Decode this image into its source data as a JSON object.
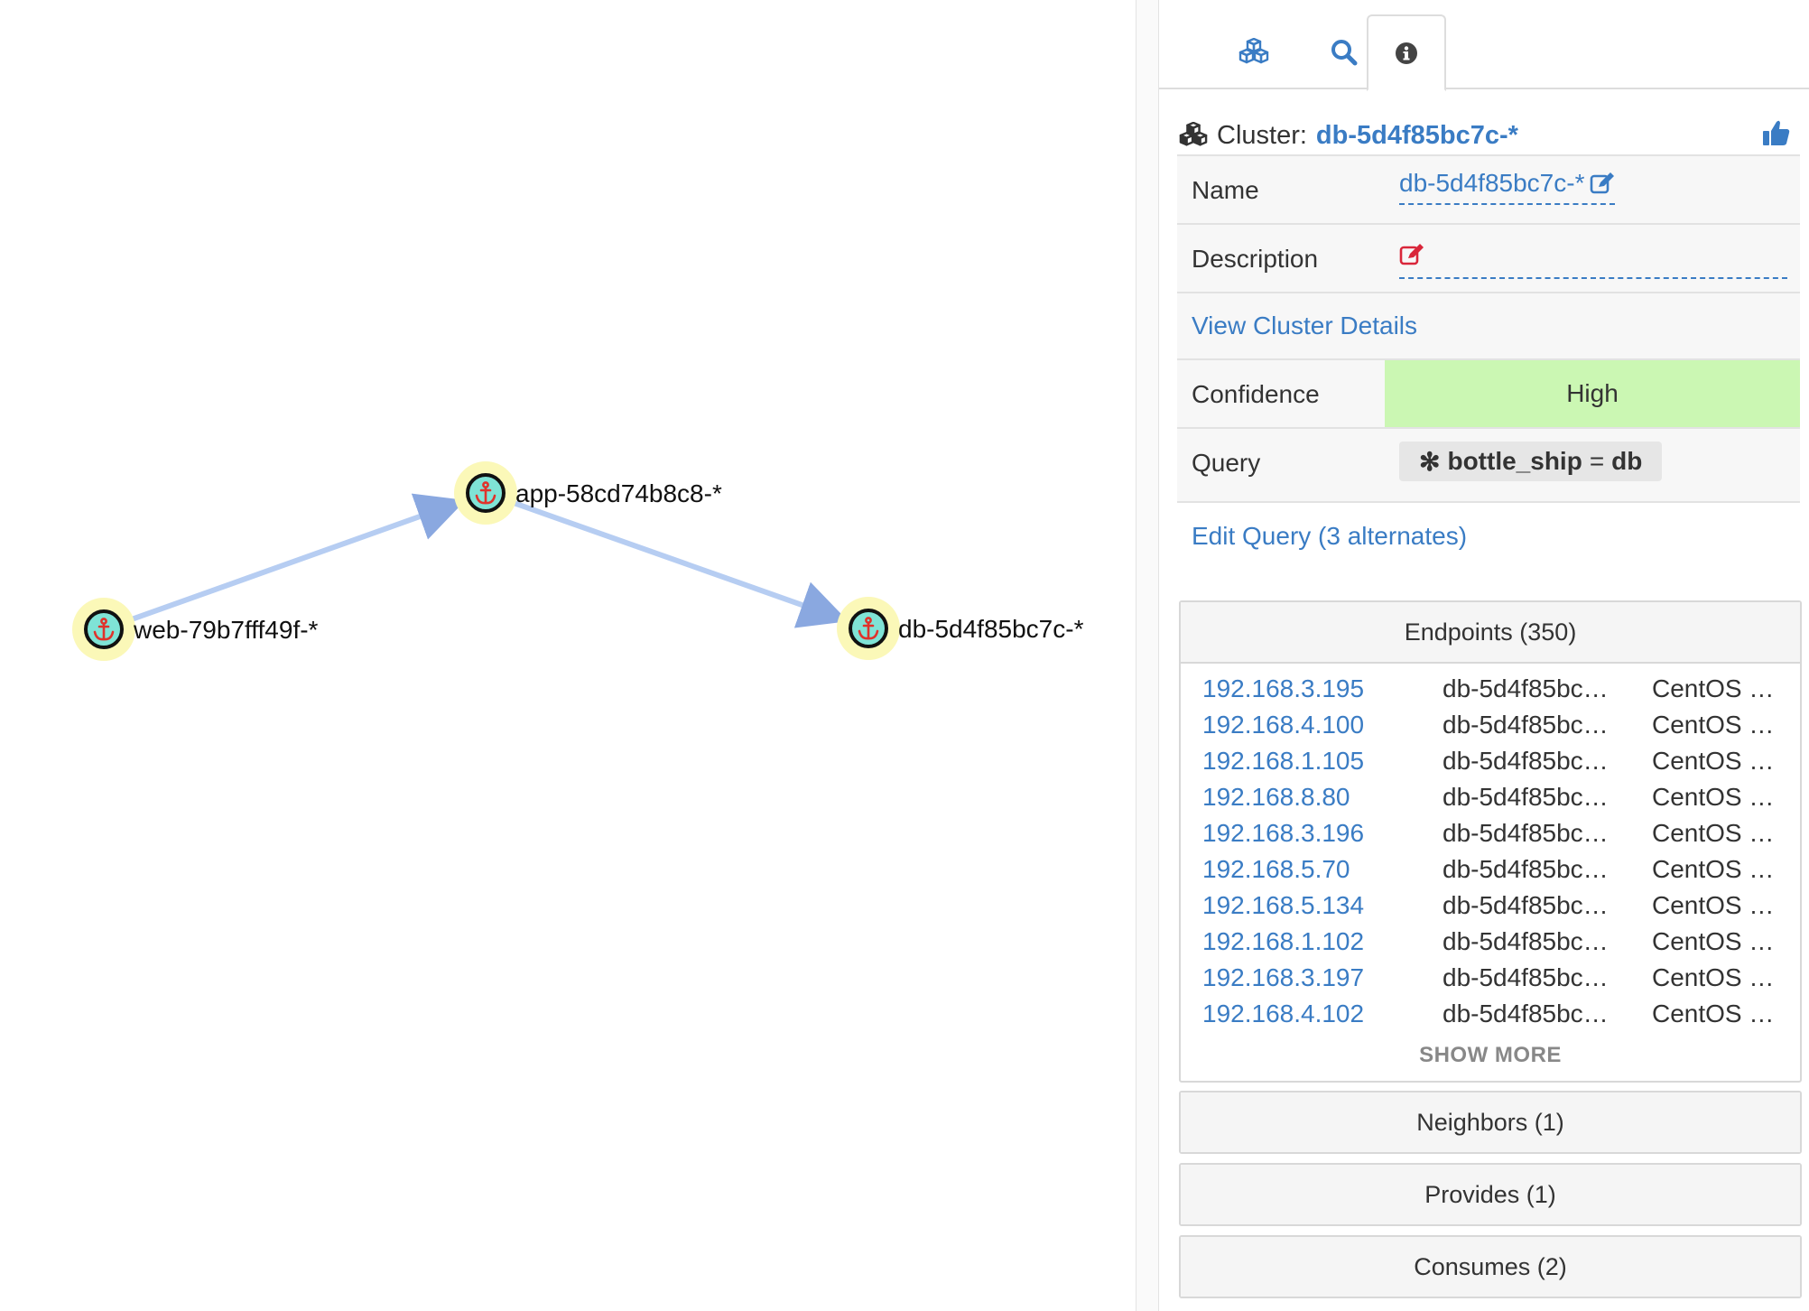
{
  "graph": {
    "nodes": [
      {
        "id": "web",
        "label": "web-79b7fff49f-*",
        "icon": "anchor-icon"
      },
      {
        "id": "app",
        "label": "app-58cd74b8c8-*",
        "icon": "anchor-icon"
      },
      {
        "id": "db",
        "label": "db-5d4f85bc7c-*",
        "icon": "anchor-icon"
      }
    ],
    "edges": [
      {
        "from": "web",
        "to": "app"
      },
      {
        "from": "app",
        "to": "db"
      }
    ],
    "colors": {
      "node_halo": "#fbf8b8",
      "node_fill": "#7fe3d6",
      "node_ring": "#111111",
      "anchor": "#e0322b",
      "edge": "#b6cdf2"
    }
  },
  "tabs": [
    {
      "icon": "cubes-icon",
      "active": false
    },
    {
      "icon": "search-icon",
      "active": false
    },
    {
      "icon": "info-icon",
      "active": true
    }
  ],
  "cluster": {
    "prefix": "Cluster:",
    "name": "db-5d4f85bc7c-*",
    "thumbs_icon": "thumbs-up-icon"
  },
  "props": {
    "name_label": "Name",
    "name_value": "db-5d4f85bc7c-*",
    "desc_label": "Description",
    "view_details": "View Cluster Details",
    "confidence_label": "Confidence",
    "confidence_value": "High",
    "query_label": "Query",
    "query_key": "bottle_ship",
    "query_op": "=",
    "query_value": "db",
    "edit_query": "Edit Query (3 alternates)"
  },
  "endpoints": {
    "title": "Endpoints (350)",
    "rows": [
      {
        "ip": "192.168.3.195",
        "name": "db-5d4f85bc…",
        "os": "CentOS …"
      },
      {
        "ip": "192.168.4.100",
        "name": "db-5d4f85bc…",
        "os": "CentOS …"
      },
      {
        "ip": "192.168.1.105",
        "name": "db-5d4f85bc…",
        "os": "CentOS …"
      },
      {
        "ip": "192.168.8.80",
        "name": "db-5d4f85bc…",
        "os": "CentOS …"
      },
      {
        "ip": "192.168.3.196",
        "name": "db-5d4f85bc…",
        "os": "CentOS …"
      },
      {
        "ip": "192.168.5.70",
        "name": "db-5d4f85bc…",
        "os": "CentOS …"
      },
      {
        "ip": "192.168.5.134",
        "name": "db-5d4f85bc…",
        "os": "CentOS …"
      },
      {
        "ip": "192.168.1.102",
        "name": "db-5d4f85bc…",
        "os": "CentOS …"
      },
      {
        "ip": "192.168.3.197",
        "name": "db-5d4f85bc…",
        "os": "CentOS …"
      },
      {
        "ip": "192.168.4.102",
        "name": "db-5d4f85bc…",
        "os": "CentOS …"
      }
    ],
    "show_more": "SHOW MORE"
  },
  "sections": {
    "neighbors": "Neighbors (1)",
    "provides": "Provides (1)",
    "consumes": "Consumes (2)"
  },
  "accent": "#3a7cc4",
  "confidence_color": "#cbf7b3"
}
